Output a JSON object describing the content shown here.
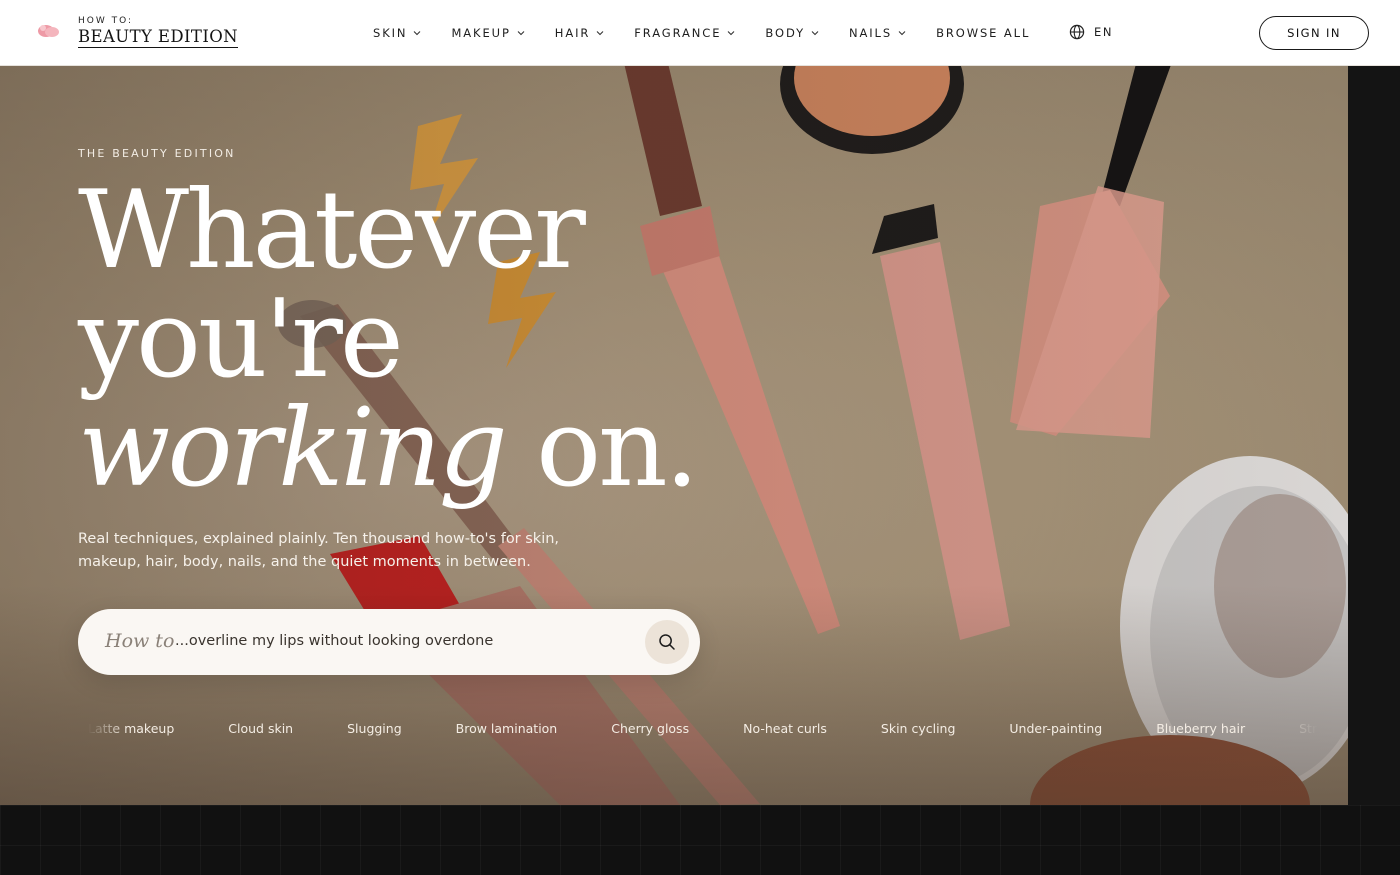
{
  "brand": {
    "small": "HOW TO:",
    "name": "BEAUTY EDITION"
  },
  "nav": {
    "items": [
      {
        "label": "SKIN",
        "has_menu": true
      },
      {
        "label": "MAKEUP",
        "has_menu": true
      },
      {
        "label": "HAIR",
        "has_menu": true
      },
      {
        "label": "FRAGRANCE",
        "has_menu": true
      },
      {
        "label": "BODY",
        "has_menu": true
      },
      {
        "label": "NAILS",
        "has_menu": true
      },
      {
        "label": "BROWSE ALL",
        "has_menu": false
      }
    ],
    "language": "EN",
    "sign_in": "SIGN IN"
  },
  "hero": {
    "eyebrow": "THE BEAUTY EDITION",
    "headline": {
      "line1": "Whatever",
      "line2": "you're",
      "line3_italic": "working",
      "line3_rest": " on."
    },
    "lede": "Real techniques, explained plainly. Ten thousand how-to's for skin, makeup, hair, body, nails, and the quiet moments in between.",
    "search": {
      "prefix": "How to",
      "value": "...overline my lips without looking overdone"
    },
    "trending": [
      "Latte makeup",
      "Cloud skin",
      "Slugging",
      "Brow lamination",
      "Cherry gloss",
      "No-heat curls",
      "Skin cycling",
      "Under-painting",
      "Blueberry hair",
      "Strawberry makeup"
    ]
  },
  "colors": {
    "accent_pink": "#e8a9b0",
    "hero_bg": "#a69479",
    "dark": "#111111",
    "brand_mark": "#ee9aa6"
  }
}
